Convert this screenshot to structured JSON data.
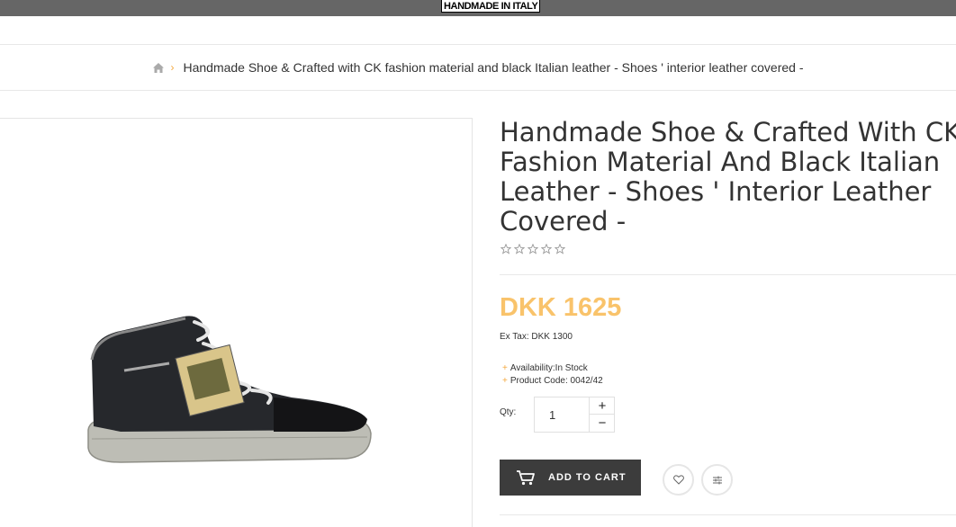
{
  "header": {
    "brand": "HANDMADE IN ITALY"
  },
  "breadcrumb": {
    "home_icon": "home-icon",
    "separator": "›",
    "current": "Handmade Shoe & Crafted with CK fashion material and black Italian leather - Shoes ' interior leather covered -"
  },
  "product": {
    "title": "Handmade Shoe & Crafted With CK Fashion Material And Black Italian Leather - Shoes ' Interior Leather Covered -",
    "rating": 0,
    "rating_max": 5,
    "price": "DKK 1625",
    "ex_tax": "Ex Tax: DKK 1300",
    "availability": "Availability:In Stock",
    "product_code": "Product Code: 0042/42",
    "qty_label": "Qty:",
    "qty_value": "1",
    "qty_plus": "+",
    "qty_minus": "−",
    "add_to_cart": "ADD TO CART",
    "bullet": "+"
  },
  "colors": {
    "topbar": "#666666",
    "accent": "#f9c36b",
    "button": "#3c3c3c"
  },
  "icons": [
    "home-icon",
    "star-icon",
    "cart-icon",
    "heart-icon",
    "compare-icon"
  ]
}
